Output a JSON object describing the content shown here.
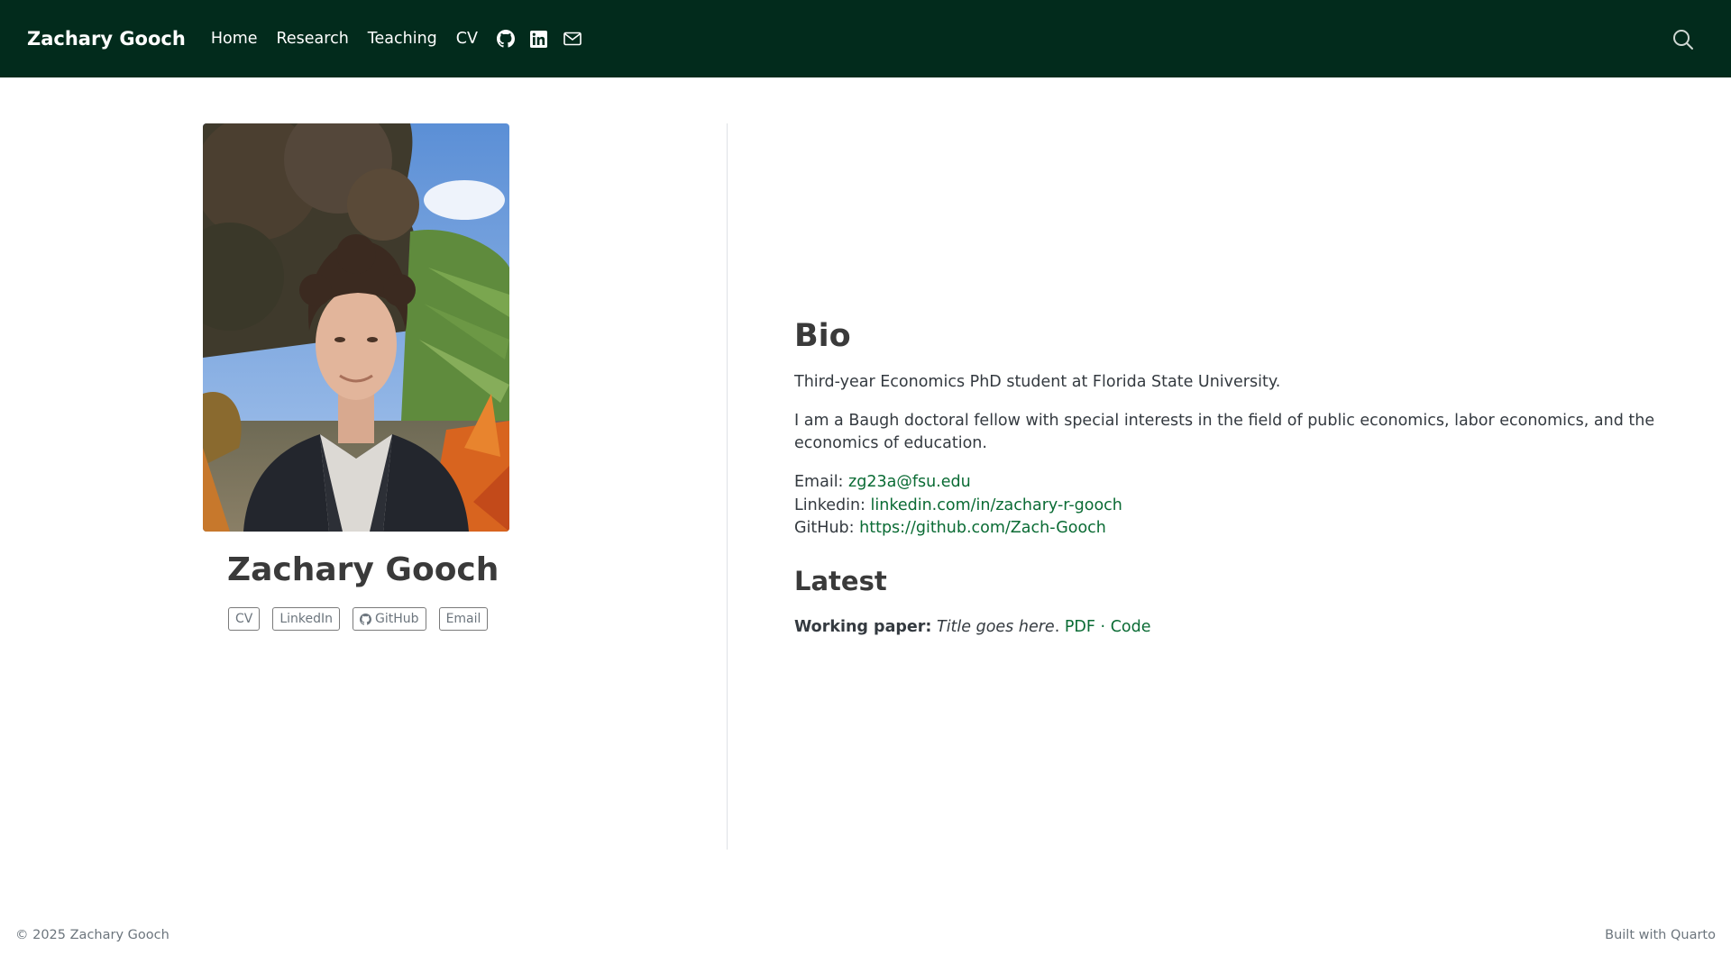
{
  "navbar": {
    "brand": "Zachary Gooch",
    "links": [
      {
        "label": "Home"
      },
      {
        "label": "Research"
      },
      {
        "label": "Teaching"
      },
      {
        "label": "CV"
      }
    ],
    "icons": [
      "github-icon",
      "linkedin-icon",
      "mail-icon"
    ],
    "search_icon": "search-icon",
    "background": "#022b1c"
  },
  "profile": {
    "name": "Zachary Gooch",
    "links": [
      {
        "label": "CV"
      },
      {
        "label": "LinkedIn"
      },
      {
        "label": "GitHub",
        "icon": "github-icon"
      },
      {
        "label": "Email"
      }
    ]
  },
  "bio": {
    "heading": "Bio",
    "paragraph1": "Third-year Economics PhD student at Florida State University.",
    "paragraph2": "I am a Baugh doctoral fellow with special interests in the field of public economics, labor economics, and the economics of education.",
    "contacts": [
      {
        "label": "Email:",
        "value": "zg23a@fsu.edu"
      },
      {
        "label": "Linkedin:",
        "value": "linkedin.com/in/zachary-r-gooch"
      },
      {
        "label": "GitHub:",
        "value": "https://github.com/Zach-Gooch"
      }
    ]
  },
  "latest": {
    "heading": "Latest",
    "kind": "Working paper:",
    "title": "Title goes here",
    "period": ".",
    "pdf_label": "PDF",
    "separator": "·",
    "code_label": "Code"
  },
  "footer": {
    "left": "© 2025 Zachary Gooch",
    "right": "Built with Quarto"
  },
  "colors": {
    "link": "#0a6b34",
    "text": "#343a40"
  }
}
